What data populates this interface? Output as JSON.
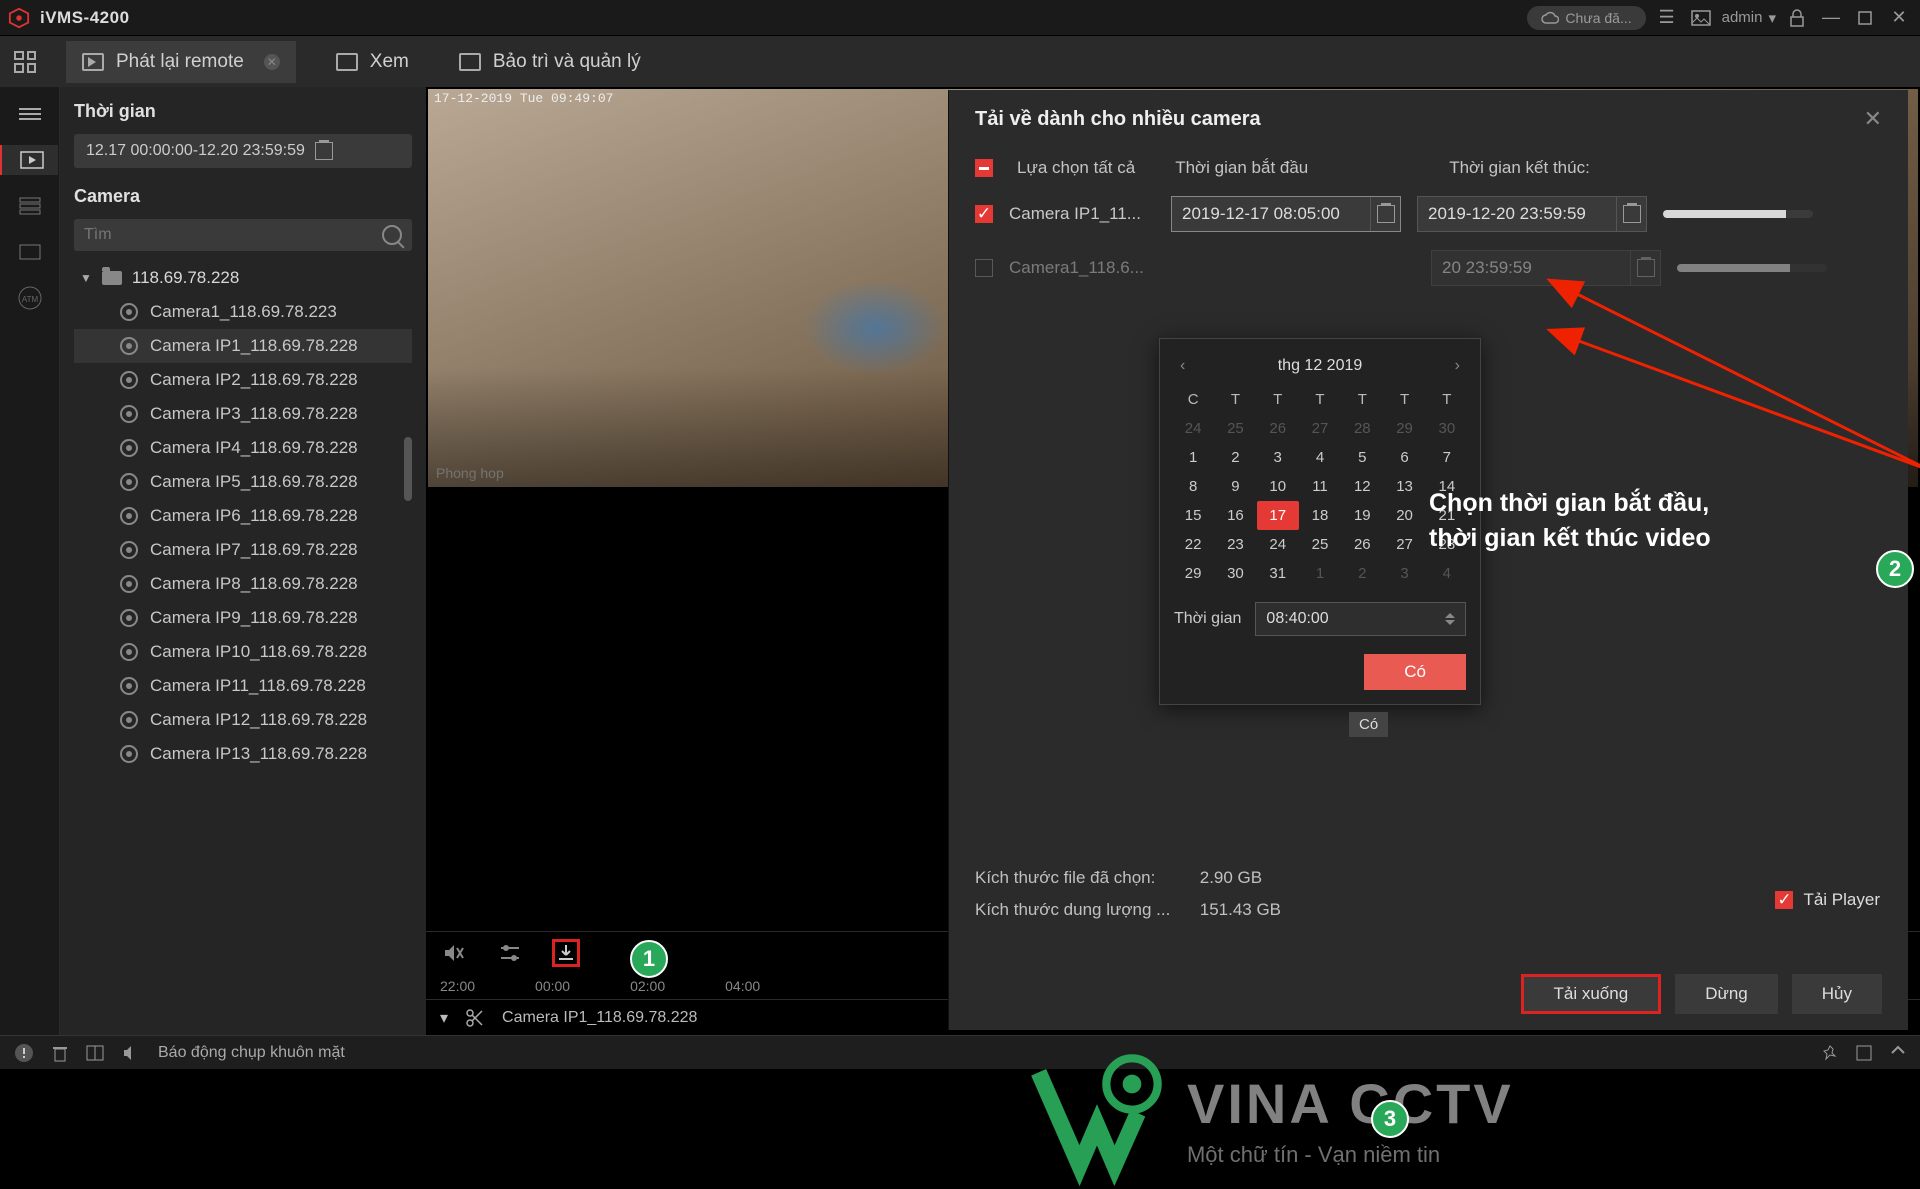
{
  "app": {
    "title": "iVMS-4200",
    "cloud_status": "Chưa đă...",
    "user": "admin"
  },
  "tabs": [
    {
      "label": "Phát lại remote",
      "active": true
    },
    {
      "label": "Xem",
      "active": false
    },
    {
      "label": "Bảo trì và quản lý",
      "active": false
    }
  ],
  "sidebar": {
    "time_label": "Thời gian",
    "time_range": "12.17 00:00:00-12.20 23:59:59",
    "camera_label": "Camera",
    "search_placeholder": "Tìm",
    "group": "118.69.78.228",
    "cameras": [
      "Camera1_118.69.78.223",
      "Camera IP1_118.69.78.228",
      "Camera IP2_118.69.78.228",
      "Camera IP3_118.69.78.228",
      "Camera IP4_118.69.78.228",
      "Camera IP5_118.69.78.228",
      "Camera IP6_118.69.78.228",
      "Camera IP7_118.69.78.228",
      "Camera IP8_118.69.78.228",
      "Camera IP9_118.69.78.228",
      "Camera IP10_118.69.78.228",
      "Camera IP11_118.69.78.228",
      "Camera IP12_118.69.78.228",
      "Camera IP13_118.69.78.228"
    ],
    "selected_index": 1
  },
  "preview": {
    "timestamp": "17-12-2019 Tue 09:49:07",
    "room_label": "Phong hop"
  },
  "timeline": {
    "ticks": [
      "22:00",
      "00:00",
      "02:00",
      "04:00"
    ]
  },
  "clipbar": {
    "camera": "Camera IP1_118.69.78.228",
    "count": "1"
  },
  "download": {
    "title": "Tải về dành cho nhiều camera",
    "select_all": "Lựa chọn tất cả",
    "start_label": "Thời gian bắt đầu",
    "end_label": "Thời gian kết thúc:",
    "rows": [
      {
        "name": "Camera IP1_11...",
        "checked": true,
        "start": "2019-12-17 08:05:00",
        "end": "2019-12-20 23:59:59",
        "progress": 82
      },
      {
        "name": "Camera1_118.6...",
        "checked": false,
        "start": "",
        "end": "20 23:59:59",
        "progress": 75
      }
    ],
    "calendar": {
      "month_label": "thg 12  2019",
      "dow": [
        "C",
        "T",
        "T",
        "T",
        "T",
        "T",
        "T"
      ],
      "leading": [
        24,
        25,
        26,
        27,
        28,
        29,
        30
      ],
      "days": [
        1,
        2,
        3,
        4,
        5,
        6,
        7,
        8,
        9,
        10,
        11,
        12,
        13,
        14,
        15,
        16,
        17,
        18,
        19,
        20,
        21,
        22,
        23,
        24,
        25,
        26,
        27,
        28,
        29,
        30,
        31
      ],
      "trailing": [
        1,
        2,
        3,
        4
      ],
      "selected": 17,
      "time_label": "Thời gian",
      "time_value": "08:40:00",
      "ok": "Có",
      "tooltip": "Có"
    },
    "stats": {
      "size_label": "Kích thước file đã chọn:",
      "size_value": "2.90 GB",
      "cap_label": "Kích thước dung lượng ...",
      "cap_value": "151.43 GB"
    },
    "player_check": "Tải Player",
    "buttons": {
      "download": "Tải xuống",
      "stop": "Dừng",
      "cancel": "Hủy"
    }
  },
  "watermark": {
    "main": "VINA CCTV",
    "sub": "Một chữ tín - Vạn niềm tin"
  },
  "annotation": {
    "text": "Chọn thời gian bắt đầu,\nthời gian kết thúc video"
  },
  "statusbar": {
    "text": "Báo động chụp khuôn mặt"
  }
}
